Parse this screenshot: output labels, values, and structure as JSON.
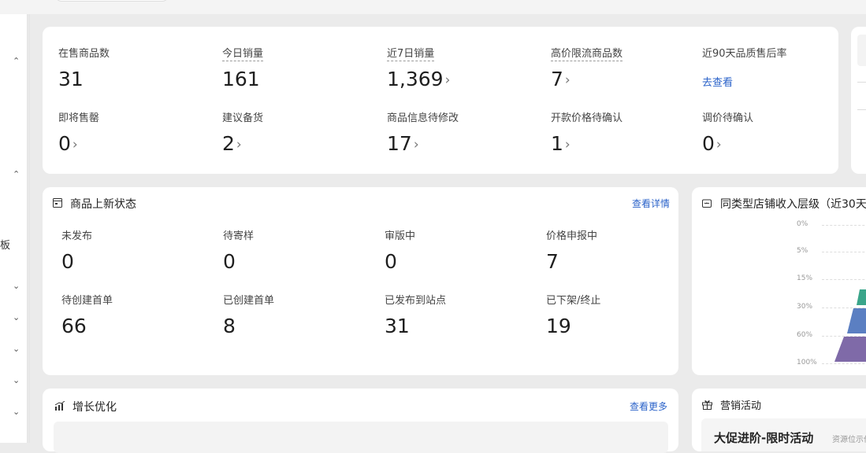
{
  "overview": {
    "stats": [
      {
        "label": "在售商品数",
        "value": "31",
        "arrow": false,
        "underline": false
      },
      {
        "label": "今日销量",
        "value": "161",
        "arrow": false,
        "underline": true
      },
      {
        "label": "近7日销量",
        "value": "1,369",
        "arrow": true,
        "underline": true
      },
      {
        "label": "高价限流商品数",
        "value": "7",
        "arrow": true,
        "underline": true
      },
      {
        "label": "近90天品质售后率",
        "link": "去查看"
      },
      {
        "label": "即将售罄",
        "value": "0",
        "arrow": true
      },
      {
        "label": "建议备货",
        "value": "2",
        "arrow": true
      },
      {
        "label": "商品信息待修改",
        "value": "17",
        "arrow": true
      },
      {
        "label": "开款价格待确认",
        "value": "1",
        "arrow": true
      },
      {
        "label": "调价待确认",
        "value": "0",
        "arrow": true
      }
    ]
  },
  "listing_status": {
    "title": "商品上新状态",
    "detail_link": "查看详情",
    "items": [
      {
        "label": "未发布",
        "value": "0"
      },
      {
        "label": "待寄样",
        "value": "0"
      },
      {
        "label": "审版中",
        "value": "0"
      },
      {
        "label": "价格申报中",
        "value": "7"
      },
      {
        "label": "待创建首单",
        "value": "66"
      },
      {
        "label": "已创建首单",
        "value": "8"
      },
      {
        "label": "已发布到站点",
        "value": "31"
      },
      {
        "label": "已下架/终止",
        "value": "19"
      }
    ]
  },
  "income_level": {
    "title": "同类型店铺收入层级（近30天",
    "tiers": [
      "0%",
      "5%",
      "15%",
      "30%",
      "60%",
      "100%"
    ],
    "colors": [
      "#3aa58a",
      "#5b7fc2",
      "#7f6aa8"
    ]
  },
  "growth": {
    "title": "增长优化",
    "more_link": "查看更多"
  },
  "marketing": {
    "title": "营销活动",
    "banner_title": "大促进阶-限时活动",
    "banner_sub": "资源位示价"
  },
  "sidebar": {
    "fragment": "板"
  }
}
